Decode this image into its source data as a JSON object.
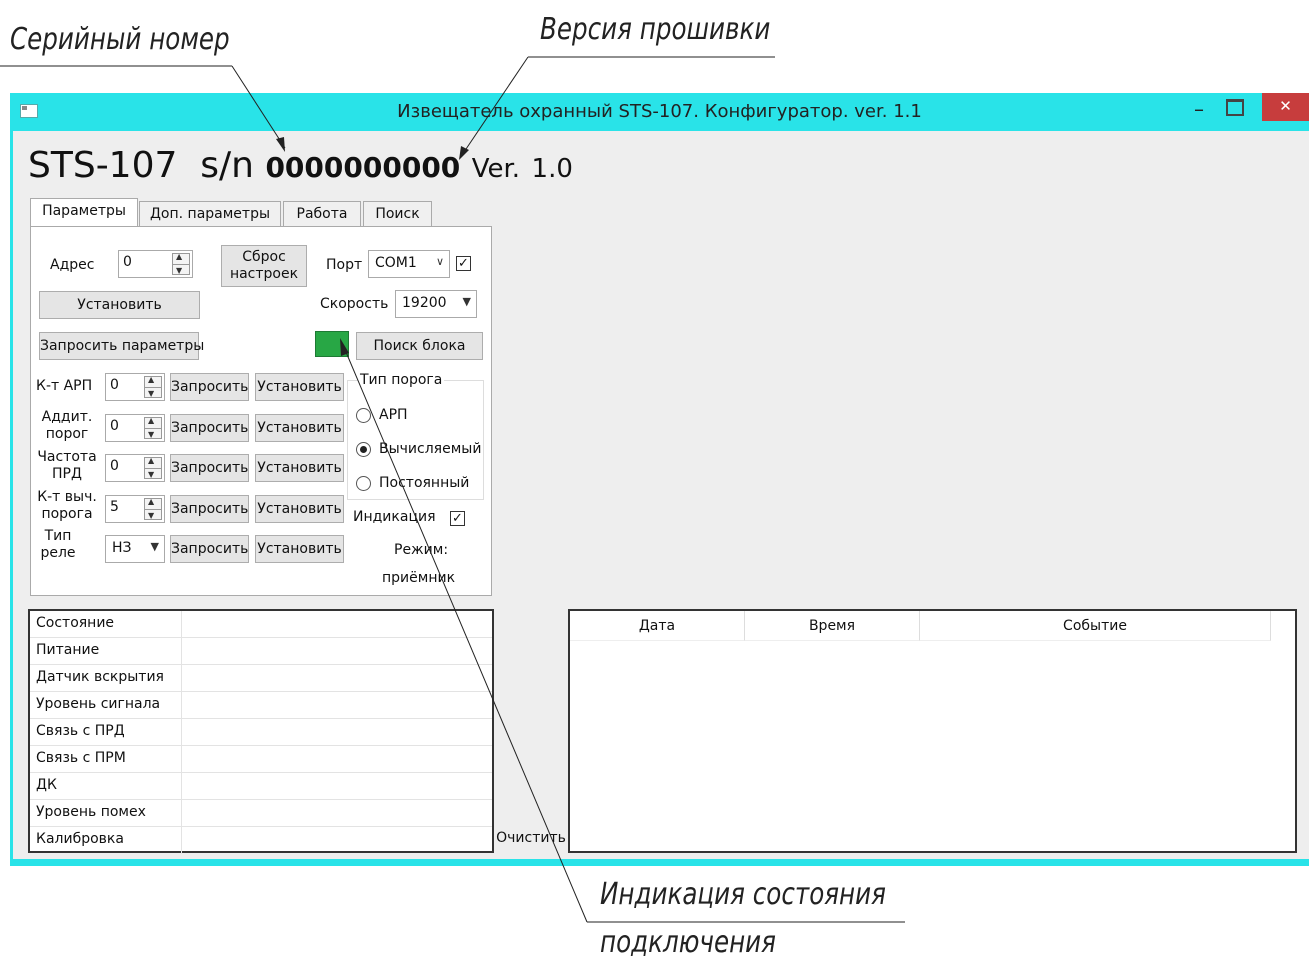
{
  "annotations": {
    "serial": "Серийный номер",
    "firmware": "Версия прошивки",
    "indication_line1": "Индикация состояния",
    "indication_line2": "подключения"
  },
  "window": {
    "title": "Извещатель охранный STS-107. Конфигуратор. ver. 1.1",
    "minimize": "–",
    "close": "✕"
  },
  "header": {
    "model": "STS-107",
    "sn_label": "s/n",
    "serial": "0000000000",
    "ver_label": "Ver.",
    "version": "1.0"
  },
  "tabs": [
    {
      "label": "Параметры",
      "active": true
    },
    {
      "label": "Доп. параметры",
      "active": false
    },
    {
      "label": "Работа",
      "active": false
    },
    {
      "label": "Поиск",
      "active": false
    }
  ],
  "params": {
    "address_label": "Адрес",
    "address_value": "0",
    "reset_line1": "Сброс",
    "reset_line2": "настроек",
    "port_label": "Порт",
    "port_value": "COM1",
    "port_checked": true,
    "speed_label": "Скорость",
    "speed_value": "19200",
    "set_button": "Установить",
    "request_params_button": "Запросить параметры",
    "search_unit_button": "Поиск блока",
    "connection_led_color": "#28a745",
    "rows": [
      {
        "label1": "К-т АРП",
        "label2": "",
        "value": "0",
        "kind": "spin"
      },
      {
        "label1": "Аддит.",
        "label2": "порог",
        "value": "0",
        "kind": "spin"
      },
      {
        "label1": "Частота",
        "label2": "ПРД",
        "value": "0",
        "kind": "spin"
      },
      {
        "label1": "К-т выч.",
        "label2": "порога",
        "value": "5",
        "kind": "spin"
      },
      {
        "label1": "Тип",
        "label2": "реле",
        "value": "НЗ",
        "kind": "combo"
      }
    ],
    "request_button": "Запросить",
    "set_row_button": "Установить",
    "threshold_group_label": "Тип порога",
    "threshold_options": [
      {
        "label": "АРП",
        "selected": false
      },
      {
        "label": "Вычисляемый",
        "selected": true
      },
      {
        "label": "Постоянный",
        "selected": false
      }
    ],
    "indication_label": "Индикация",
    "indication_checked": true,
    "mode_label": "Режим:",
    "mode_value": "приёмник"
  },
  "status": {
    "rows": [
      {
        "name": "Состояние",
        "value": ""
      },
      {
        "name": "Питание",
        "value": ""
      },
      {
        "name": "Датчик вскрытия",
        "value": ""
      },
      {
        "name": "Уровень сигнала",
        "value": ""
      },
      {
        "name": "Связь с ПРД",
        "value": ""
      },
      {
        "name": "Связь с ПРМ",
        "value": ""
      },
      {
        "name": "ДК",
        "value": ""
      },
      {
        "name": "Уровень помех",
        "value": ""
      },
      {
        "name": "Калибровка",
        "value": ""
      }
    ],
    "clear_button": "Очистить"
  },
  "events": {
    "columns": [
      "Дата",
      "Время",
      "Событие"
    ]
  }
}
